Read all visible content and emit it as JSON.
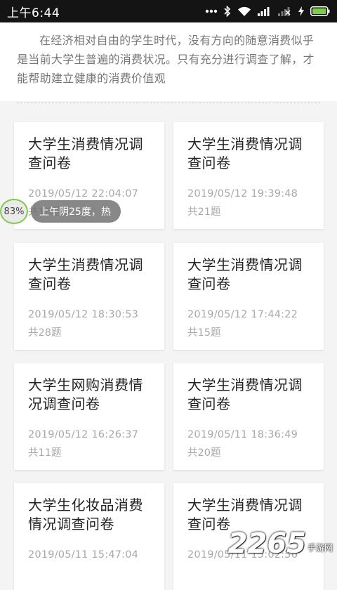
{
  "status_bar": {
    "time": "上午6:44",
    "colors": {
      "background": "#141414",
      "battery": "#7fca4a"
    }
  },
  "intro": {
    "text": "在经济相对自由的学生时代，没有方向的随意消费似乎是当前大学生普遍的消费状况。只有充分进行调查了解，才能帮助建立健康的消费价值观"
  },
  "surveys": [
    {
      "title": "大学生消费情况调查问卷",
      "date": "2019/05/12 22:04:07",
      "count": "共16题"
    },
    {
      "title": "大学生消费情况调查问卷",
      "date": "2019/05/12 19:39:48",
      "count": "共21题"
    },
    {
      "title": "大学生消费情况调查问卷",
      "date": "2019/05/12 18:30:53",
      "count": "共28题"
    },
    {
      "title": "大学生消费情况调查问卷",
      "date": "2019/05/12 17:44:22",
      "count": "共15题"
    },
    {
      "title": "大学生网购消费情况调查问卷",
      "date": "2019/05/12 16:26:37",
      "count": "共11题"
    },
    {
      "title": "大学生消费情况调查问卷",
      "date": "2019/05/11 18:36:49",
      "count": "共20题"
    },
    {
      "title": "大学生化妆品消费情况调查问卷",
      "date": "2019/05/11 15:47:04",
      "count": ""
    },
    {
      "title": "大学生消费情况调查问卷",
      "date": "2019/05/11 15:02:56",
      "count": ""
    }
  ],
  "overlay": {
    "battery_percent": "83%",
    "weather": "上午阴25度，热"
  },
  "watermark": {
    "number": "2265",
    "site": "手游网"
  }
}
